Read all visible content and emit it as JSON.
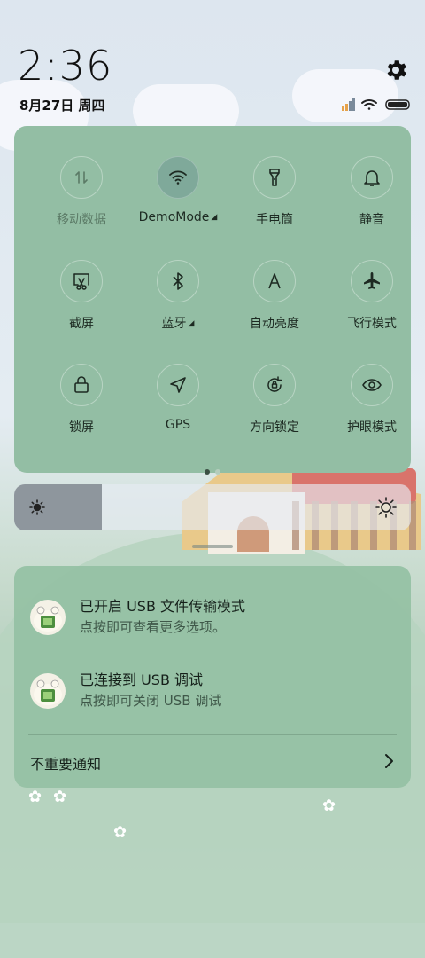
{
  "status": {
    "time": "2:36",
    "date": "8月27日 周四"
  },
  "quick_settings": {
    "tiles": [
      {
        "label": "移动数据",
        "icon": "mobile-data-icon",
        "active": false
      },
      {
        "label": "DemoMode",
        "icon": "wifi-icon",
        "active": true
      },
      {
        "label": "手电筒",
        "icon": "flashlight-icon",
        "active": false
      },
      {
        "label": "静音",
        "icon": "bell-icon",
        "active": false
      },
      {
        "label": "截屏",
        "icon": "screenshot-icon",
        "active": false
      },
      {
        "label": "蓝牙",
        "icon": "bluetooth-icon",
        "active": false
      },
      {
        "label": "自动亮度",
        "icon": "auto-brightness-icon",
        "active": false
      },
      {
        "label": "飞行模式",
        "icon": "airplane-icon",
        "active": false
      },
      {
        "label": "锁屏",
        "icon": "lock-icon",
        "active": false
      },
      {
        "label": "GPS",
        "icon": "location-arrow-icon",
        "active": false
      },
      {
        "label": "方向锁定",
        "icon": "rotation-lock-icon",
        "active": false
      },
      {
        "label": "护眼模式",
        "icon": "eye-icon",
        "active": false
      }
    ],
    "page_index": 1,
    "page_count": 2
  },
  "brightness": {
    "level_percent": 22
  },
  "notifications": [
    {
      "title": "已开启 USB 文件传输模式",
      "subtitle": "点按即可查看更多选项。",
      "icon": "usb-app-icon"
    },
    {
      "title": "已连接到 USB 调试",
      "subtitle": "点按即可关闭 USB 调试",
      "icon": "usb-app-icon"
    }
  ],
  "unimportant_label": "不重要通知",
  "colors": {
    "panel": "#93bea4",
    "active_tile": "#7fa99a",
    "brightness_fill": "#8e969d"
  }
}
